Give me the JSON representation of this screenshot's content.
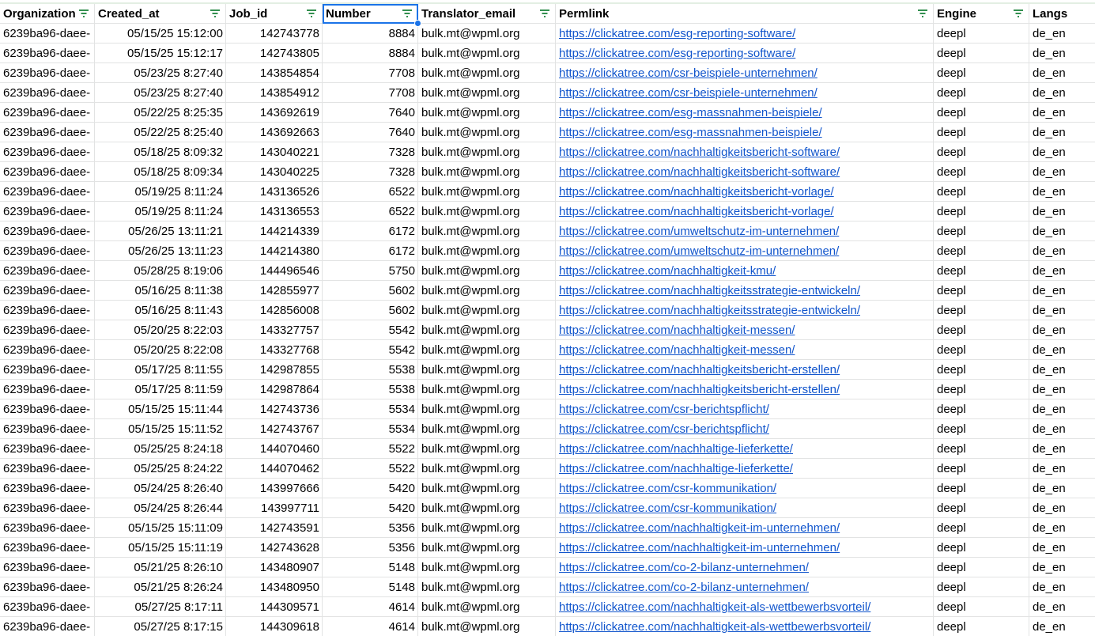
{
  "header": {
    "organization": "Organization",
    "created_at": "Created_at",
    "job_id": "Job_id",
    "number": "Number",
    "translator_email": "Translator_email",
    "permlink": "Permlink",
    "engine": "Engine",
    "langs": "Langs"
  },
  "filter_icon_color": "#188038",
  "selection_color": "#1a73e8",
  "link_color": "#1155cc",
  "rows": [
    {
      "org": "6239ba96-daee-",
      "created": "05/15/25 15:12:00",
      "job": "142743778",
      "num": "8884",
      "email": "bulk.mt@wpml.org",
      "link": "https://clickatree.com/esg-reporting-software/",
      "engine": "deepl",
      "langs": "de_en"
    },
    {
      "org": "6239ba96-daee-",
      "created": "05/15/25 15:12:17",
      "job": "142743805",
      "num": "8884",
      "email": "bulk.mt@wpml.org",
      "link": "https://clickatree.com/esg-reporting-software/",
      "engine": "deepl",
      "langs": "de_en"
    },
    {
      "org": "6239ba96-daee-",
      "created": "05/23/25 8:27:40",
      "job": "143854854",
      "num": "7708",
      "email": "bulk.mt@wpml.org",
      "link": "https://clickatree.com/csr-beispiele-unternehmen/",
      "engine": "deepl",
      "langs": "de_en"
    },
    {
      "org": "6239ba96-daee-",
      "created": "05/23/25 8:27:40",
      "job": "143854912",
      "num": "7708",
      "email": "bulk.mt@wpml.org",
      "link": "https://clickatree.com/csr-beispiele-unternehmen/",
      "engine": "deepl",
      "langs": "de_en"
    },
    {
      "org": "6239ba96-daee-",
      "created": "05/22/25 8:25:35",
      "job": "143692619",
      "num": "7640",
      "email": "bulk.mt@wpml.org",
      "link": "https://clickatree.com/esg-massnahmen-beispiele/",
      "engine": "deepl",
      "langs": "de_en"
    },
    {
      "org": "6239ba96-daee-",
      "created": "05/22/25 8:25:40",
      "job": "143692663",
      "num": "7640",
      "email": "bulk.mt@wpml.org",
      "link": "https://clickatree.com/esg-massnahmen-beispiele/",
      "engine": "deepl",
      "langs": "de_en"
    },
    {
      "org": "6239ba96-daee-",
      "created": "05/18/25 8:09:32",
      "job": "143040221",
      "num": "7328",
      "email": "bulk.mt@wpml.org",
      "link": "https://clickatree.com/nachhaltigkeitsbericht-software/",
      "engine": "deepl",
      "langs": "de_en"
    },
    {
      "org": "6239ba96-daee-",
      "created": "05/18/25 8:09:34",
      "job": "143040225",
      "num": "7328",
      "email": "bulk.mt@wpml.org",
      "link": "https://clickatree.com/nachhaltigkeitsbericht-software/",
      "engine": "deepl",
      "langs": "de_en"
    },
    {
      "org": "6239ba96-daee-",
      "created": "05/19/25 8:11:24",
      "job": "143136526",
      "num": "6522",
      "email": "bulk.mt@wpml.org",
      "link": "https://clickatree.com/nachhaltigkeitsbericht-vorlage/",
      "engine": "deepl",
      "langs": "de_en"
    },
    {
      "org": "6239ba96-daee-",
      "created": "05/19/25 8:11:24",
      "job": "143136553",
      "num": "6522",
      "email": "bulk.mt@wpml.org",
      "link": "https://clickatree.com/nachhaltigkeitsbericht-vorlage/",
      "engine": "deepl",
      "langs": "de_en"
    },
    {
      "org": "6239ba96-daee-",
      "created": "05/26/25 13:11:21",
      "job": "144214339",
      "num": "6172",
      "email": "bulk.mt@wpml.org",
      "link": "https://clickatree.com/umweltschutz-im-unternehmen/",
      "engine": "deepl",
      "langs": "de_en"
    },
    {
      "org": "6239ba96-daee-",
      "created": "05/26/25 13:11:23",
      "job": "144214380",
      "num": "6172",
      "email": "bulk.mt@wpml.org",
      "link": "https://clickatree.com/umweltschutz-im-unternehmen/",
      "engine": "deepl",
      "langs": "de_en"
    },
    {
      "org": "6239ba96-daee-",
      "created": "05/28/25 8:19:06",
      "job": "144496546",
      "num": "5750",
      "email": "bulk.mt@wpml.org",
      "link": "https://clickatree.com/nachhaltigkeit-kmu/",
      "engine": "deepl",
      "langs": "de_en"
    },
    {
      "org": "6239ba96-daee-",
      "created": "05/16/25 8:11:38",
      "job": "142855977",
      "num": "5602",
      "email": "bulk.mt@wpml.org",
      "link": "https://clickatree.com/nachhaltigkeitsstrategie-entwickeln/",
      "engine": "deepl",
      "langs": "de_en"
    },
    {
      "org": "6239ba96-daee-",
      "created": "05/16/25 8:11:43",
      "job": "142856008",
      "num": "5602",
      "email": "bulk.mt@wpml.org",
      "link": "https://clickatree.com/nachhaltigkeitsstrategie-entwickeln/",
      "engine": "deepl",
      "langs": "de_en"
    },
    {
      "org": "6239ba96-daee-",
      "created": "05/20/25 8:22:03",
      "job": "143327757",
      "num": "5542",
      "email": "bulk.mt@wpml.org",
      "link": "https://clickatree.com/nachhaltigkeit-messen/",
      "engine": "deepl",
      "langs": "de_en"
    },
    {
      "org": "6239ba96-daee-",
      "created": "05/20/25 8:22:08",
      "job": "143327768",
      "num": "5542",
      "email": "bulk.mt@wpml.org",
      "link": "https://clickatree.com/nachhaltigkeit-messen/",
      "engine": "deepl",
      "langs": "de_en"
    },
    {
      "org": "6239ba96-daee-",
      "created": "05/17/25 8:11:55",
      "job": "142987855",
      "num": "5538",
      "email": "bulk.mt@wpml.org",
      "link": "https://clickatree.com/nachhaltigkeitsbericht-erstellen/",
      "engine": "deepl",
      "langs": "de_en"
    },
    {
      "org": "6239ba96-daee-",
      "created": "05/17/25 8:11:59",
      "job": "142987864",
      "num": "5538",
      "email": "bulk.mt@wpml.org",
      "link": "https://clickatree.com/nachhaltigkeitsbericht-erstellen/",
      "engine": "deepl",
      "langs": "de_en"
    },
    {
      "org": "6239ba96-daee-",
      "created": "05/15/25 15:11:44",
      "job": "142743736",
      "num": "5534",
      "email": "bulk.mt@wpml.org",
      "link": "https://clickatree.com/csr-berichtspflicht/",
      "engine": "deepl",
      "langs": "de_en"
    },
    {
      "org": "6239ba96-daee-",
      "created": "05/15/25 15:11:52",
      "job": "142743767",
      "num": "5534",
      "email": "bulk.mt@wpml.org",
      "link": "https://clickatree.com/csr-berichtspflicht/",
      "engine": "deepl",
      "langs": "de_en"
    },
    {
      "org": "6239ba96-daee-",
      "created": "05/25/25 8:24:18",
      "job": "144070460",
      "num": "5522",
      "email": "bulk.mt@wpml.org",
      "link": "https://clickatree.com/nachhaltige-lieferkette/",
      "engine": "deepl",
      "langs": "de_en"
    },
    {
      "org": "6239ba96-daee-",
      "created": "05/25/25 8:24:22",
      "job": "144070462",
      "num": "5522",
      "email": "bulk.mt@wpml.org",
      "link": "https://clickatree.com/nachhaltige-lieferkette/",
      "engine": "deepl",
      "langs": "de_en"
    },
    {
      "org": "6239ba96-daee-",
      "created": "05/24/25 8:26:40",
      "job": "143997666",
      "num": "5420",
      "email": "bulk.mt@wpml.org",
      "link": "https://clickatree.com/csr-kommunikation/",
      "engine": "deepl",
      "langs": "de_en"
    },
    {
      "org": "6239ba96-daee-",
      "created": "05/24/25 8:26:44",
      "job": "143997711",
      "num": "5420",
      "email": "bulk.mt@wpml.org",
      "link": "https://clickatree.com/csr-kommunikation/",
      "engine": "deepl",
      "langs": "de_en"
    },
    {
      "org": "6239ba96-daee-",
      "created": "05/15/25 15:11:09",
      "job": "142743591",
      "num": "5356",
      "email": "bulk.mt@wpml.org",
      "link": "https://clickatree.com/nachhaltigkeit-im-unternehmen/",
      "engine": "deepl",
      "langs": "de_en"
    },
    {
      "org": "6239ba96-daee-",
      "created": "05/15/25 15:11:19",
      "job": "142743628",
      "num": "5356",
      "email": "bulk.mt@wpml.org",
      "link": "https://clickatree.com/nachhaltigkeit-im-unternehmen/",
      "engine": "deepl",
      "langs": "de_en"
    },
    {
      "org": "6239ba96-daee-",
      "created": "05/21/25 8:26:10",
      "job": "143480907",
      "num": "5148",
      "email": "bulk.mt@wpml.org",
      "link": "https://clickatree.com/co-2-bilanz-unternehmen/",
      "engine": "deepl",
      "langs": "de_en"
    },
    {
      "org": "6239ba96-daee-",
      "created": "05/21/25 8:26:24",
      "job": "143480950",
      "num": "5148",
      "email": "bulk.mt@wpml.org",
      "link": "https://clickatree.com/co-2-bilanz-unternehmen/",
      "engine": "deepl",
      "langs": "de_en"
    },
    {
      "org": "6239ba96-daee-",
      "created": "05/27/25 8:17:11",
      "job": "144309571",
      "num": "4614",
      "email": "bulk.mt@wpml.org",
      "link": "https://clickatree.com/nachhaltigkeit-als-wettbewerbsvorteil/",
      "engine": "deepl",
      "langs": "de_en"
    },
    {
      "org": "6239ba96-daee-",
      "created": "05/27/25 8:17:15",
      "job": "144309618",
      "num": "4614",
      "email": "bulk.mt@wpml.org",
      "link": "https://clickatree.com/nachhaltigkeit-als-wettbewerbsvorteil/",
      "engine": "deepl",
      "langs": "de_en"
    }
  ]
}
